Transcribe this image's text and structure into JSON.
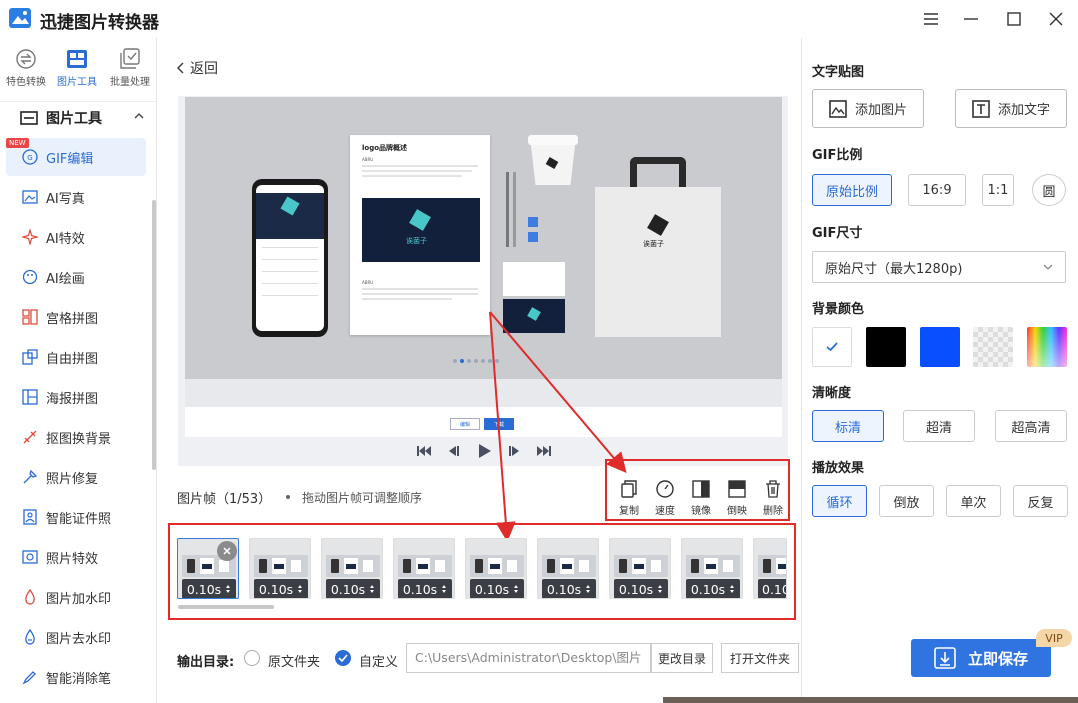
{
  "window": {
    "title": "迅捷图片转换器"
  },
  "rail_tabs": [
    {
      "label": "特色转换",
      "icon": "swap-icon"
    },
    {
      "label": "图片工具",
      "icon": "grid-icon"
    },
    {
      "label": "批量处理",
      "icon": "batch-icon"
    }
  ],
  "tools_header": "图片工具",
  "new_badge": "NEW",
  "menu": [
    {
      "label": "GIF编辑",
      "icon": "gif-icon"
    },
    {
      "label": "AI写真",
      "icon": "image-icon"
    },
    {
      "label": "AI特效",
      "icon": "sparkle-icon"
    },
    {
      "label": "AI绘画",
      "icon": "palette-icon"
    },
    {
      "label": "宫格拼图",
      "icon": "grid-puzzle-icon"
    },
    {
      "label": "自由拼图",
      "icon": "free-puzzle-icon"
    },
    {
      "label": "海报拼图",
      "icon": "poster-icon"
    },
    {
      "label": "抠图换背景",
      "icon": "cutout-icon"
    },
    {
      "label": "照片修复",
      "icon": "repair-icon"
    },
    {
      "label": "智能证件照",
      "icon": "id-photo-icon"
    },
    {
      "label": "照片特效",
      "icon": "effect-icon"
    },
    {
      "label": "图片加水印",
      "icon": "watermark-add-icon"
    },
    {
      "label": "图片去水印",
      "icon": "watermark-remove-icon"
    },
    {
      "label": "智能消除笔",
      "icon": "eraser-pen-icon"
    }
  ],
  "back_label": "返回",
  "frames": {
    "label": "图片帧（1/53）",
    "hint": "拖动图片帧可调整顺序",
    "durations": [
      "0.10s",
      "0.10s",
      "0.10s",
      "0.10s",
      "0.10s",
      "0.10s",
      "0.10s",
      "0.10s",
      "0.10"
    ]
  },
  "frame_tools": [
    {
      "label": "复制",
      "icon": "copy-icon"
    },
    {
      "label": "速度",
      "icon": "speed-icon"
    },
    {
      "label": "镜像",
      "icon": "mirror-icon"
    },
    {
      "label": "倒映",
      "icon": "reflect-icon"
    },
    {
      "label": "删除",
      "icon": "trash-icon"
    }
  ],
  "preview": {
    "doc_title": "logo品牌概述",
    "doc_sub": "ABRU",
    "brand": "诶菌子",
    "mini_edit": "编辑",
    "mini_download": "下载"
  },
  "output": {
    "label": "输出目录:",
    "opt_original": "原文件夹",
    "opt_custom": "自定义",
    "path": "C:\\Users\\Administrator\\Desktop\\图片",
    "change_dir": "更改目录",
    "open_folder": "打开文件夹"
  },
  "right": {
    "sticker_title": "文字贴图",
    "add_image": "添加图片",
    "add_text": "添加文字",
    "ratio_title": "GIF比例",
    "ratios": [
      "原始比例",
      "16:9",
      "1:1",
      "圆"
    ],
    "size_title": "GIF尺寸",
    "size_value": "原始尺寸（最大1280p)",
    "bg_title": "背景颜色",
    "bg_colors": [
      "#ffffff",
      "#000000",
      "#0a4fff"
    ],
    "clarity_title": "清晰度",
    "clarity": [
      "标清",
      "超清",
      "超高清"
    ],
    "play_title": "播放效果",
    "play": [
      "循环",
      "倒放",
      "单次",
      "反复"
    ],
    "save": "立即保存",
    "vip": "VIP"
  },
  "accent_color": "#2a6bd6",
  "highlight_color": "#e02b2b"
}
